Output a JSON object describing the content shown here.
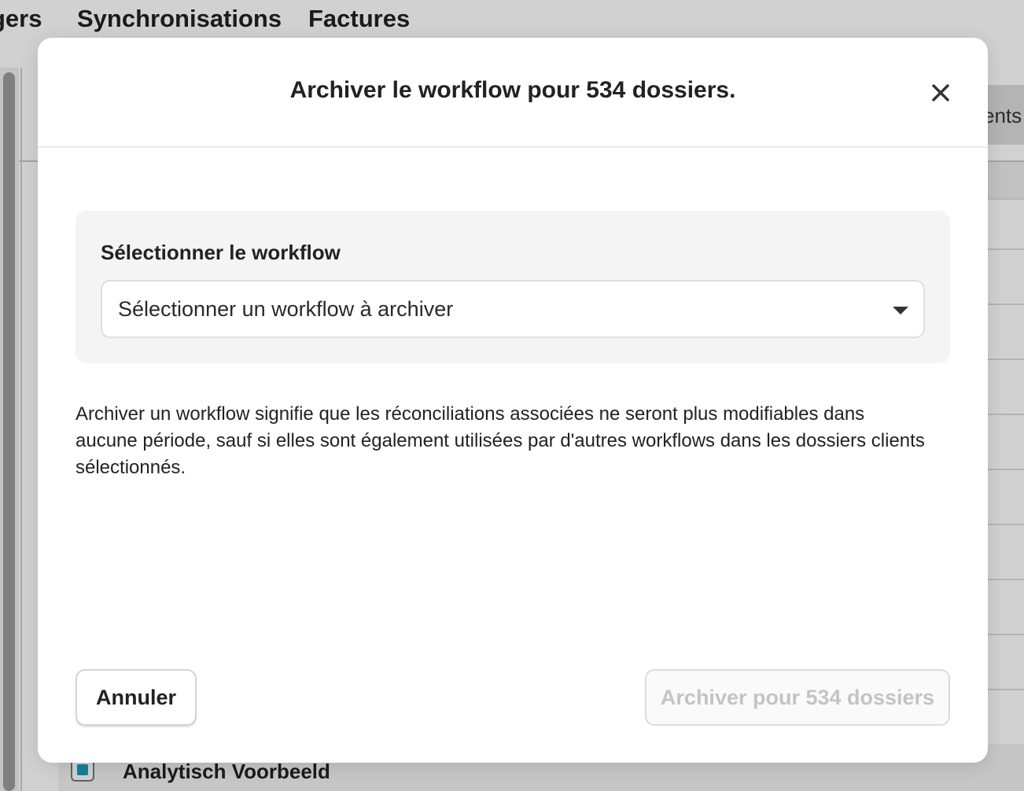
{
  "background": {
    "nav_items": [
      "gers",
      "Synchronisations",
      "Factures"
    ],
    "column_header_fragment": "ents",
    "visible_row_label": "Analytisch Voorbeeld"
  },
  "modal": {
    "title": "Archiver le workflow pour 534 dossiers.",
    "close_icon": "close-icon",
    "select_section": {
      "label": "Sélectionner le workflow",
      "placeholder": "Sélectionner un workflow à archiver",
      "caret_icon": "caret-down-icon"
    },
    "description": "Archiver un workflow signifie que les réconciliations associées ne seront plus modifiables dans aucune période, sauf si elles sont également utilisées par d'autres workflows dans les dossiers clients sélectionnés.",
    "buttons": {
      "cancel_label": "Annuler",
      "archive_label": "Archiver pour 534 dossiers",
      "archive_disabled": true
    }
  },
  "colors": {
    "checkbox_accent": "#1a9bbf",
    "disabled_text": "#c4c4c4"
  }
}
